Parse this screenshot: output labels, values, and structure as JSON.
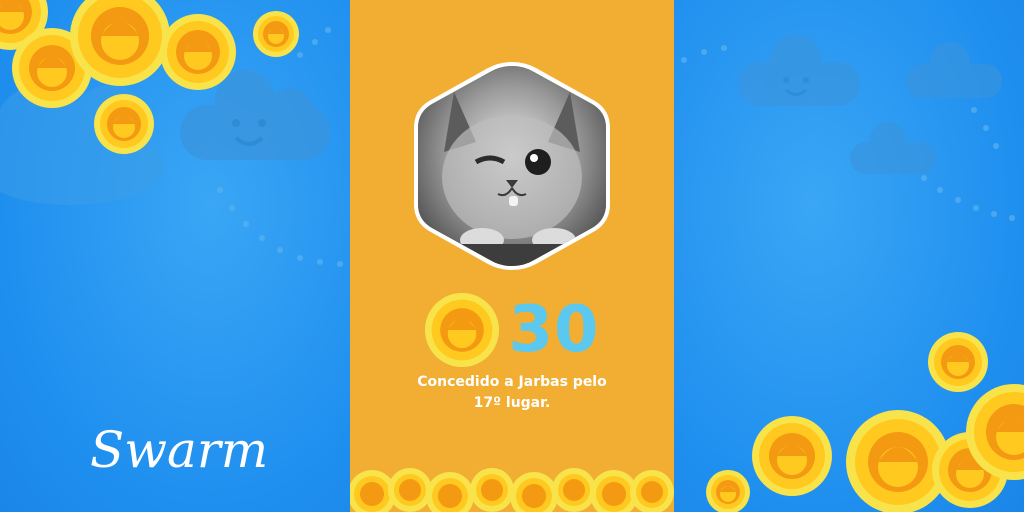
{
  "brand": {
    "logo_text": "Swarm",
    "logo_name": "swarm-logo"
  },
  "photo": {
    "subject": "kitten-photo",
    "shape": "hexagon"
  },
  "reward": {
    "coin_icon": "swarm-coin-icon",
    "value": "30"
  },
  "caption": {
    "line1": "Concedido a Jarbas pelo",
    "line2": "17º lugar."
  },
  "colors": {
    "sky_blue": "#1f8fef",
    "panel_orange": "#f2ae32",
    "coin_gold": "#ffc91f",
    "coin_rim": "#f8e34a",
    "score_blue": "#5ac8ef",
    "text_white": "#ffffff"
  }
}
